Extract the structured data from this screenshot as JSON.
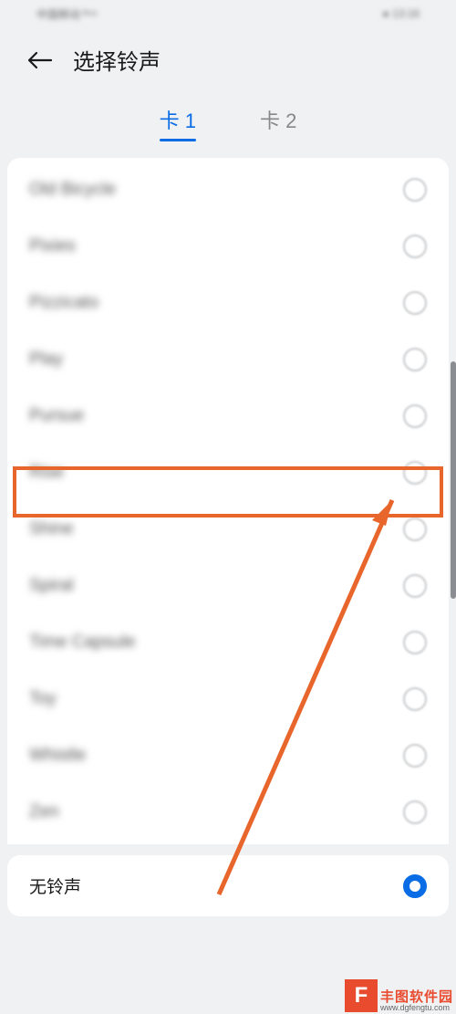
{
  "statusBar": {
    "left": "中国移动 ᴿ⁴⁶",
    "right": "● 13:16"
  },
  "header": {
    "title": "选择铃声"
  },
  "tabs": [
    {
      "label": "卡 1",
      "active": true
    },
    {
      "label": "卡 2",
      "active": false
    }
  ],
  "ringtones": [
    {
      "label": "Old Bicycle",
      "selected": false
    },
    {
      "label": "Pixies",
      "selected": false
    },
    {
      "label": "Pizzicato",
      "selected": false
    },
    {
      "label": "Play",
      "selected": false
    },
    {
      "label": "Pursue",
      "selected": false
    },
    {
      "label": "Rise",
      "selected": false,
      "highlighted": true
    },
    {
      "label": "Shine",
      "selected": false
    },
    {
      "label": "Spiral",
      "selected": false
    },
    {
      "label": "Time Capsule",
      "selected": false
    },
    {
      "label": "Toy",
      "selected": false
    },
    {
      "label": "Whistle",
      "selected": false
    },
    {
      "label": "Zen",
      "selected": false
    }
  ],
  "noRingtone": {
    "label": "无铃声",
    "selected": true
  },
  "watermark": {
    "logoGlyph": "F",
    "name": "丰图软件园",
    "url": "www.dgfengtu.com"
  },
  "annotation": {
    "highlightColor": "#e8652b",
    "arrowColor": "#e8652b"
  }
}
